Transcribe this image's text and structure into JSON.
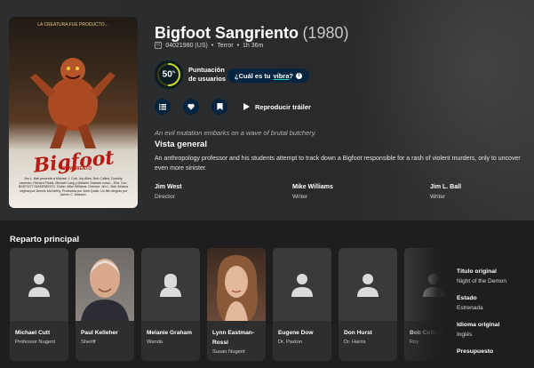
{
  "movie": {
    "title": "Bigfoot Sangriento",
    "year": "(1980)",
    "certification": "R",
    "release": "04021980 (US)",
    "bullet": "•",
    "genre": "Terror",
    "runtime": "1h 36m"
  },
  "poster": {
    "top_line": "LA CREATURA FUE PRODUCTO...",
    "big_title": "Bigfoot",
    "subtitle": "SANGRIENTO",
    "credits": "Jim L. Ball presenta a Michael J. Cutt, Joy Allen, Bob Collins, Dorothy Lacenen, Richard Fields, Michael Lang y Melanie Graham como ...Ella. Con: BIGFOOT SANGRIENTO. Guión: Mike Williams. Director: Jim L. Ball. Música original por Dennis McCarthy. Producida por John Quick. Un film dirigido por James C. Wasson."
  },
  "rating": {
    "score": 50,
    "score_text": "50",
    "percent": "%",
    "label": "Puntuación de usuarios",
    "vibe_prefix": "¿Cuál es tu",
    "vibe_word": "vibra",
    "vibe_suffix": "?",
    "ring_color": "#d2d531",
    "track_color": "#423d0f"
  },
  "actions": {
    "list_icon": "list-icon",
    "fav_icon": "heart-icon",
    "watch_icon": "bookmark-icon",
    "trailer_label": "Reproducir tráiler"
  },
  "tagline": "An evil mutation embarks on a wave of brutal butchery.",
  "overview": {
    "heading": "Vista general",
    "text": "An anthropology professor and his students attempt to track down a Bigfoot responsible for a rash of violent murders, only to uncover even more sinister."
  },
  "crew": [
    {
      "name": "Jim West",
      "job": "Director"
    },
    {
      "name": "Mike Williams",
      "job": "Writer"
    },
    {
      "name": "Jim L. Ball",
      "job": "Writer"
    }
  ],
  "cast_heading": "Reparto principal",
  "cast": [
    {
      "name": "Michael Cutt",
      "role": "Professor Nugent",
      "photo": "placeholder"
    },
    {
      "name": "Paul Kelleher",
      "role": "Sheriff",
      "photo": "portrait-man"
    },
    {
      "name": "Melanie Graham",
      "role": "Wanda",
      "photo": "placeholder-female"
    },
    {
      "name": "Lynn Eastman-Rossi",
      "role": "Susan Nugent",
      "photo": "portrait-woman"
    },
    {
      "name": "Eugene Dow",
      "role": "Dr. Paxton",
      "photo": "placeholder"
    },
    {
      "name": "Don Hurst",
      "role": "Dr. Harris",
      "photo": "placeholder"
    },
    {
      "name": "Bob Collins",
      "role": "Roy",
      "photo": "placeholder"
    }
  ],
  "facts": [
    {
      "label": "Título original",
      "value": "Night of the Demon"
    },
    {
      "label": "Estado",
      "value": "Estrenada"
    },
    {
      "label": "Idioma original",
      "value": "Inglés"
    },
    {
      "label": "Presupuesto",
      "value": ""
    }
  ]
}
